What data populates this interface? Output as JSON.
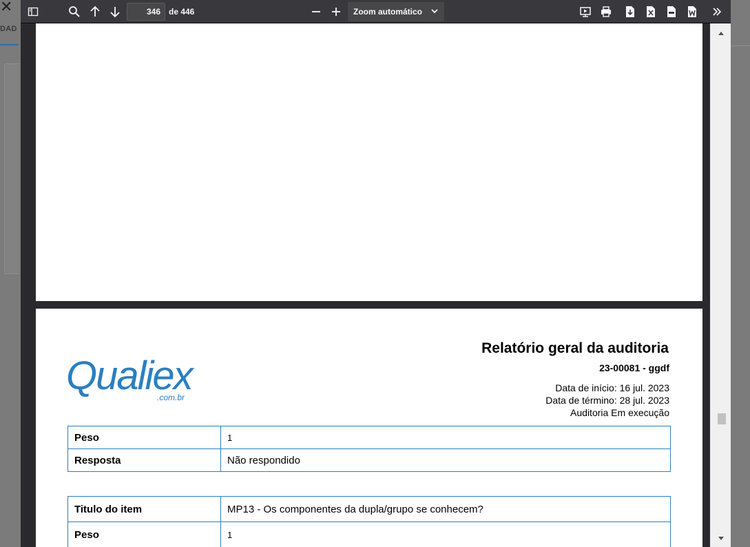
{
  "background": {
    "tab_fragment": "DAD"
  },
  "toolbar": {
    "current_page": "346",
    "page_total": "de 446",
    "zoom_value": "Zoom automático",
    "icons": [
      "sidebar-toggle-icon",
      "search-icon",
      "arrow-up-icon",
      "arrow-down-icon",
      "zoom-out-icon",
      "zoom-in-icon",
      "presentation-icon",
      "print-icon",
      "download-icon",
      "excel-icon",
      "csv-icon",
      "word-icon",
      "more-tools-icon"
    ]
  },
  "report": {
    "logo_text": "Qualiex",
    "logo_subtext": ".com.br",
    "title": "Relatório geral da auditoria",
    "code": "23-00081 - ggdf",
    "start_date": "Data de início: 16 jul. 2023",
    "end_date": "Data de término: 28 jul. 2023",
    "status": "Auditoria Em execução",
    "table1": [
      {
        "key": "Peso",
        "value": "1"
      },
      {
        "key": "Resposta",
        "value": "Não respondido"
      }
    ],
    "table2": [
      {
        "key": "Titulo do item",
        "value": "MP13 - Os componentes da dupla/grupo se conhecem?"
      },
      {
        "key": "Peso",
        "value": "1"
      }
    ]
  },
  "colors": {
    "toolbar": "#38383d",
    "viewer_bg": "#2a2a2e",
    "brand_blue": "#2c7fc0"
  }
}
